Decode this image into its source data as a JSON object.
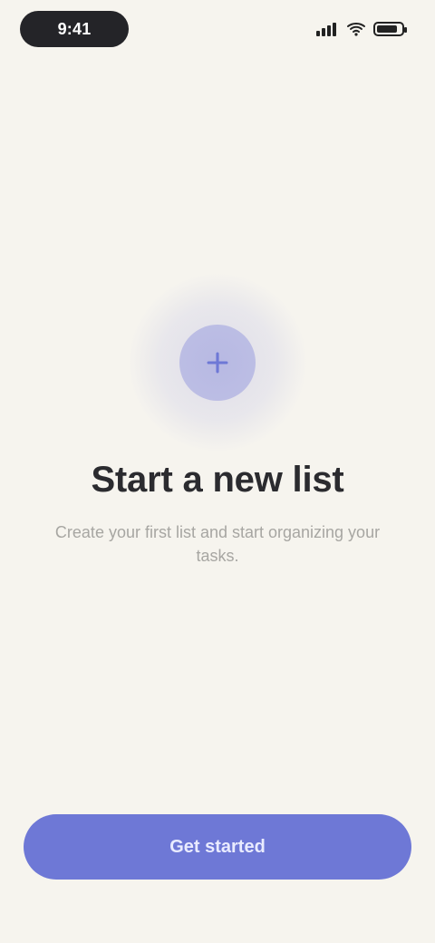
{
  "status_bar": {
    "time": "9:41",
    "icons": [
      "signal-icon",
      "wifi-icon",
      "battery-icon"
    ]
  },
  "empty_state": {
    "icon_name": "add-icon",
    "title": "Start a new list",
    "subtitle": "Create your first list and start organizing your tasks."
  },
  "primary_action": {
    "label": "Get started"
  },
  "colors": {
    "background": "#F6F4EE",
    "accent": "#6E78D6",
    "title": "#2B2B2F",
    "subtitle": "#A7A6A2"
  }
}
